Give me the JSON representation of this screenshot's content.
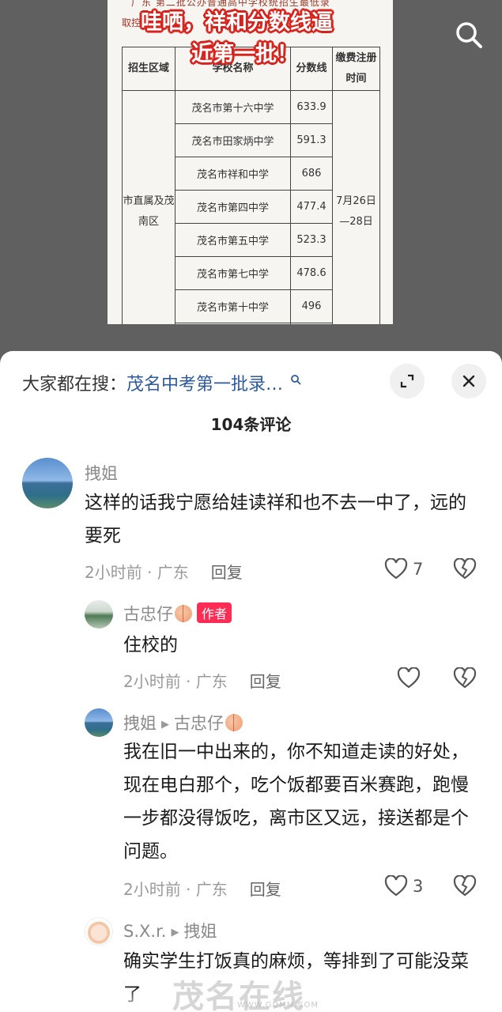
{
  "document": {
    "top_line": "广东  第二批公办普通高中学校统招生最低录",
    "prefix": "取控",
    "headline_line1": "哇哂，祥和分数线逼",
    "headline_line2": "近第一批！",
    "table": {
      "headers": [
        "招生区域",
        "学校名称",
        "分数线",
        "缴费注册时间"
      ],
      "region": "市直属及茂南区",
      "date": "7月26日—28日",
      "rows": [
        {
          "school": "茂名市第十六中学",
          "score": "633.9"
        },
        {
          "school": "茂名市田家炳中学",
          "score": "591.3"
        },
        {
          "school": "茂名市祥和中学",
          "score": "686"
        },
        {
          "school": "茂名市第四中学",
          "score": "477.4"
        },
        {
          "school": "茂名市第五中学",
          "score": "523.3"
        },
        {
          "school": "茂名市第七中学",
          "score": "478.6"
        },
        {
          "school": "茂名市第十中学",
          "score": "496"
        }
      ]
    }
  },
  "sheet": {
    "hot_search_prefix": "大家都在搜：",
    "hot_search_keyword": "茂名中考第一批录…",
    "comment_count": "104条评论",
    "comments": [
      {
        "user": "拽姐",
        "text": "这样的话我宁愿给娃读祥和也不去一中了，远的要死",
        "time_loc": "2小时前 · 广东",
        "reply": "回复",
        "likes": "7"
      },
      {
        "user": "古忠仔",
        "tag": "作者",
        "text": "住校的",
        "time_loc": "2小时前 · 广东",
        "reply": "回复",
        "likes": ""
      },
      {
        "user": "拽姐",
        "reply_to": "古忠仔",
        "text": "我在旧一中出来的，你不知道走读的好处，现在电白那个，吃个饭都要百米赛跑，跑慢一步都没得饭吃，离市区又远，接送都是个问题。",
        "time_loc": "2小时前 · 广东",
        "reply": "回复",
        "likes": "3"
      },
      {
        "user": "S.X.r.",
        "reply_to": "拽姐",
        "text": "确实学生打饭真的麻烦，等排到了可能没菜了",
        "time_loc": "",
        "reply": "",
        "likes": ""
      }
    ]
  },
  "watermark": {
    "main": "茂名在线",
    "sub": "WWW.GDMM.COM"
  },
  "icons": {
    "search": "search-icon",
    "expand": "expand-icon",
    "close": "close-icon",
    "like": "heart-icon",
    "dislike": "broken-heart-icon"
  },
  "colors": {
    "author_tag": "#fe2c55",
    "hot_keyword": "#2d5a9c",
    "headline_stroke": "#d8231d"
  }
}
